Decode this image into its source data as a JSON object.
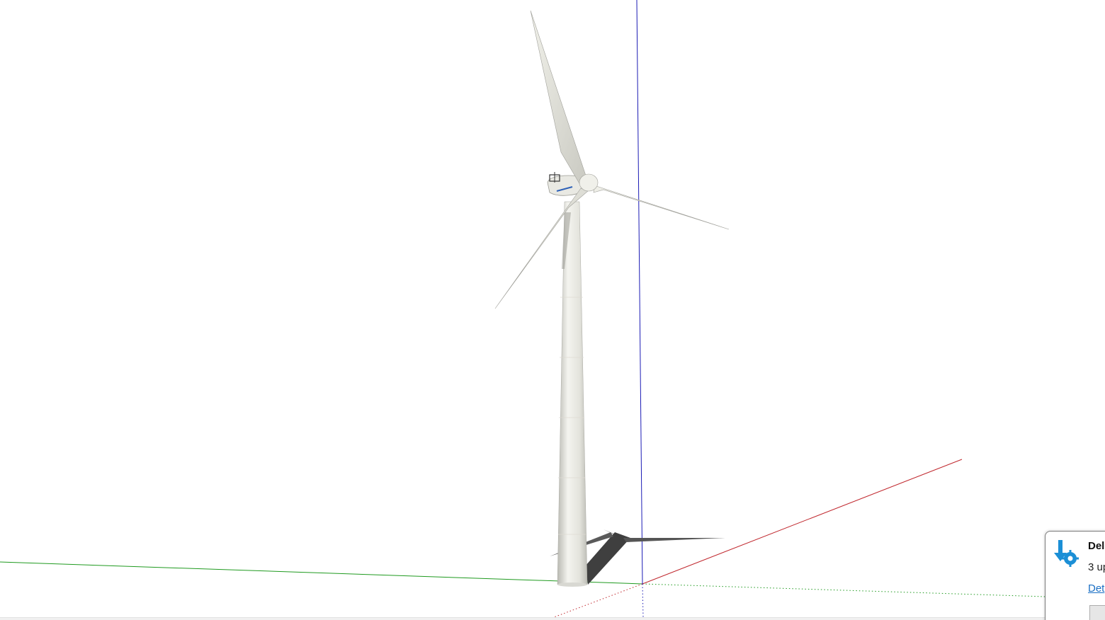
{
  "viewport": {
    "background": "#ffffff",
    "axis_colors": {
      "red": "#c0272d",
      "green": "#1f9a1f",
      "blue": "#1b1bb5"
    }
  },
  "model": {
    "name": "wind-turbine",
    "color": "#ecece6",
    "shadow": "#3d3d3d"
  },
  "notification": {
    "title": "Del",
    "body": "3 up",
    "link": "Det",
    "icon": "update-gear-icon",
    "accent": "#1b8fd6"
  }
}
